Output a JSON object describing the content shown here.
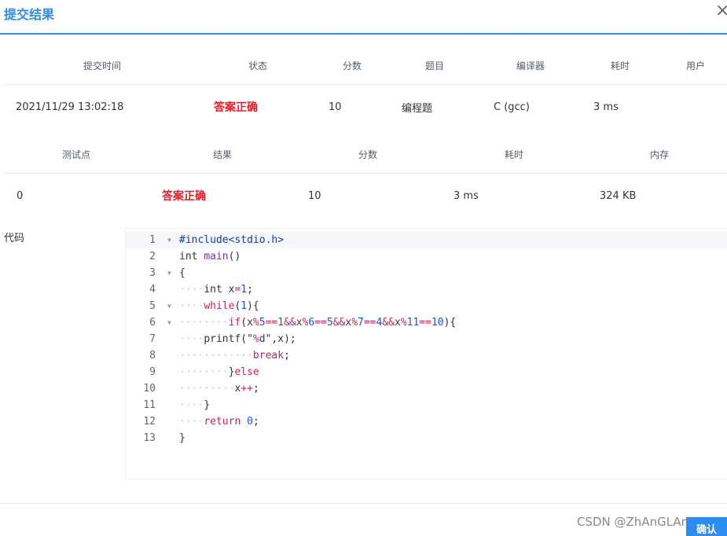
{
  "dialog": {
    "title": "提交结果",
    "close_glyph": "×",
    "confirm_label": "确认"
  },
  "submission_table": {
    "headers": [
      "提交时间",
      "状态",
      "分数",
      "题目",
      "编译器",
      "耗时",
      "用户"
    ],
    "row": {
      "time": "2021/11/29 13:02:18",
      "status": "答案正确",
      "score": "10",
      "problem": "编程题",
      "compiler": "C (gcc)",
      "duration": "3 ms",
      "user": ""
    }
  },
  "testcase_table": {
    "headers": [
      "测试点",
      "结果",
      "分数",
      "耗时",
      "内存"
    ],
    "row": {
      "case": "0",
      "result": "答案正确",
      "score": "10",
      "duration": "3 ms",
      "memory": "324 KB"
    }
  },
  "code": {
    "label": "代码",
    "lines": [
      "#include<stdio.h>",
      "int main()",
      "{",
      "    int x=1;",
      "    while(1){",
      "        if(x%5==1&&x%6==5&&x%7==4&&x%11==10){",
      "    printf(\"%d\",x);",
      "            break;",
      "        }else",
      "         x++;",
      "    }",
      "    return 0;",
      "}"
    ]
  },
  "watermark": "CSDN @ZhAnGLAnn-",
  "colors": {
    "accent": "#2d8cf0",
    "status_ok": "#ed1c24"
  }
}
